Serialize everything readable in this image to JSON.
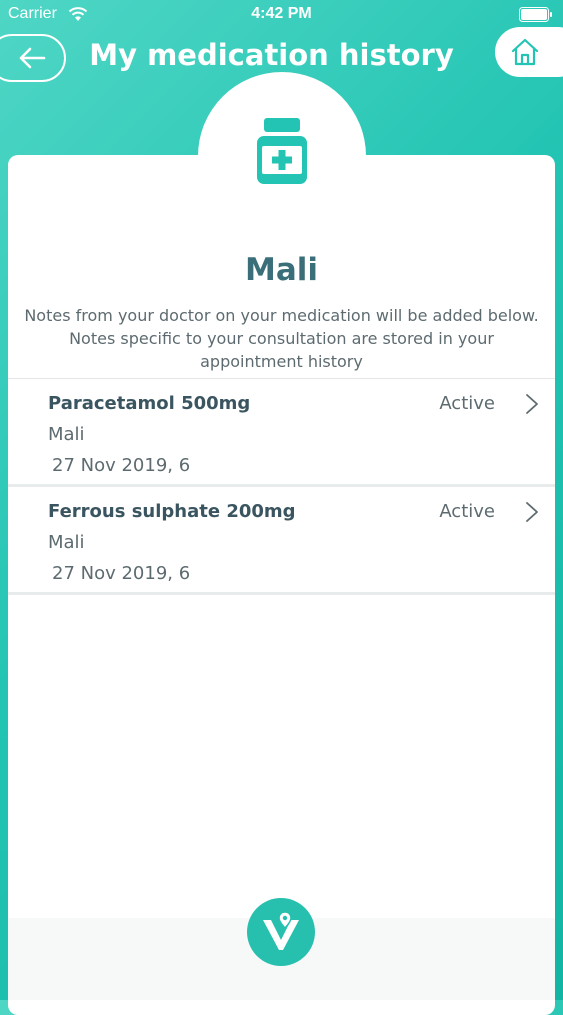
{
  "status_bar": {
    "carrier": "Carrier",
    "time": "4:42 PM"
  },
  "header": {
    "title": "My medication history",
    "back_icon": "arrow-left-icon",
    "home_icon": "house-icon"
  },
  "card": {
    "badge_icon": "medicine-bottle-icon",
    "patient_name": "Mali",
    "notes": "Notes from your doctor on your medication will be added below. Notes specific to your consultation are stored in your appointment history"
  },
  "medications": [
    {
      "name": "Paracetamol 500mg",
      "status": "Active",
      "patient": "Mali",
      "date": "27 Nov 2019, 6"
    },
    {
      "name": "Ferrous sulphate 200mg",
      "status": "Active",
      "patient": "Mali",
      "date": "27 Nov 2019, 6"
    }
  ],
  "colors": {
    "accent": "#23c4b3",
    "title_text": "#3a6f79",
    "body_text": "#5d6b70"
  },
  "footer": {
    "logo_icon": "v-pin-logo-icon"
  }
}
